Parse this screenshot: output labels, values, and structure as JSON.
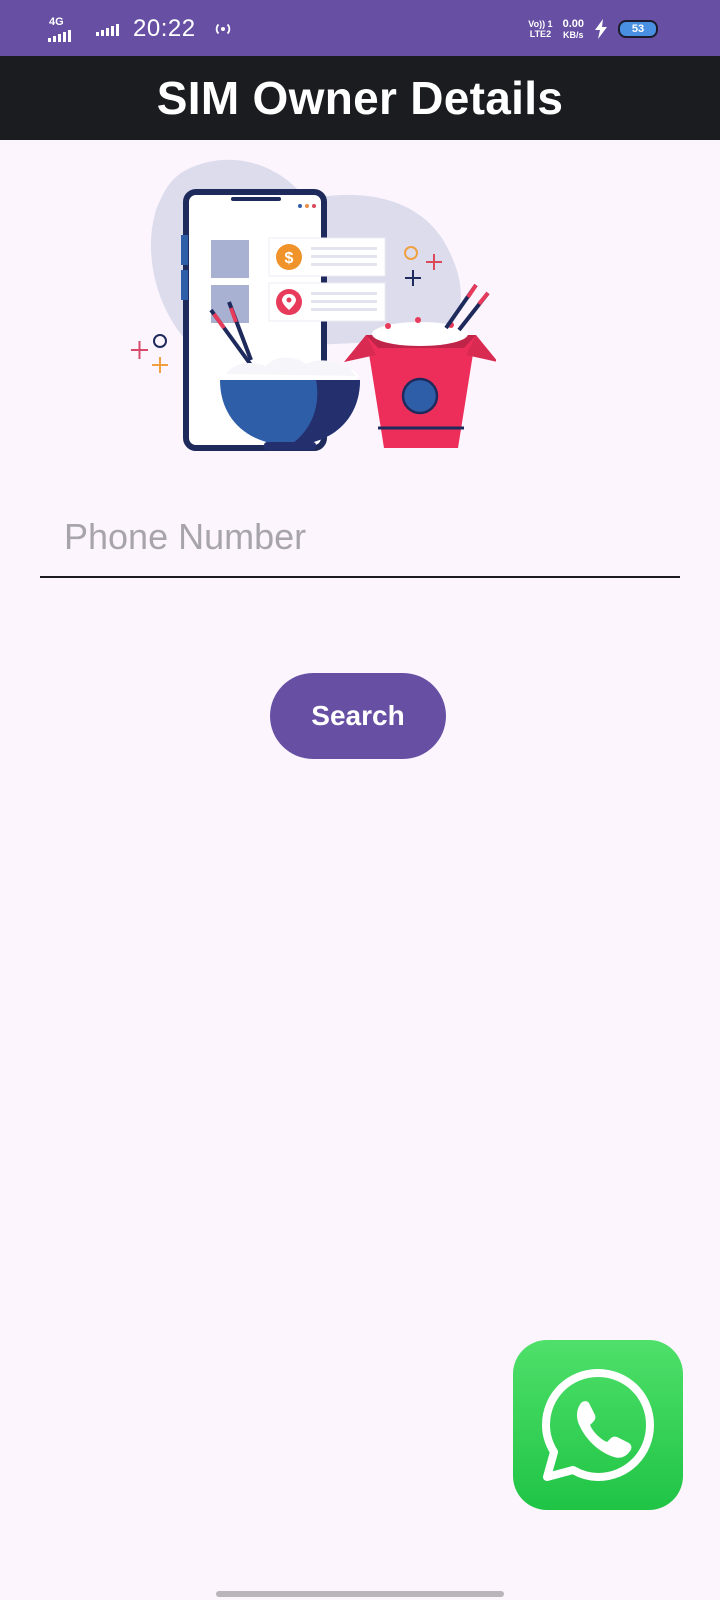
{
  "status_bar": {
    "network_type": "4G",
    "time": "20:22",
    "volte_line1": "Vo)) 1",
    "volte_line2": "LTE2",
    "net_speed_value": "0.00",
    "net_speed_unit": "KB/s",
    "battery_level": "53"
  },
  "app_bar": {
    "title": "SIM Owner Details"
  },
  "form": {
    "phone_placeholder": "Phone Number",
    "phone_value": "",
    "search_label": "Search"
  },
  "icons": {
    "illustration": "phone-with-food-illustration",
    "fab": "whatsapp-icon",
    "charging": "bolt-icon",
    "hotspot": "hotspot-icon"
  },
  "colors": {
    "primary": "#6750a4",
    "app_bar": "#1a1c1f",
    "background": "#fcf5fd",
    "whatsapp_green": "#25d366"
  }
}
